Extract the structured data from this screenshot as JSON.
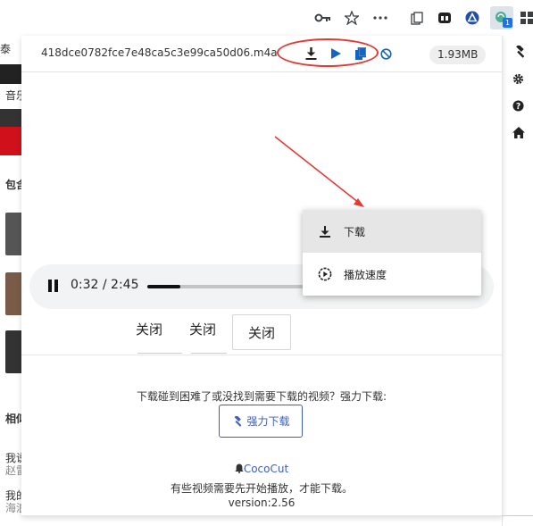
{
  "browser": {
    "toolbar_icons": [
      "key-icon",
      "star-icon",
      "more-icon",
      "collections-icon",
      "ext-dark-icon",
      "ext-delta-icon",
      "cococut-extension-icon",
      "extensions-grid-icon"
    ],
    "extension_badge": "1"
  },
  "background_page": {
    "texts": [
      "泰",
      "音乐",
      "包含",
      "相似",
      "我说",
      "赵雷",
      "我的",
      "海浪"
    ]
  },
  "sidebar": {
    "icons": [
      "hammer-icon",
      "gear-icon",
      "help-icon",
      "home-icon"
    ]
  },
  "popup": {
    "filename": "418dce0782fce7e48ca5c3e99ca50d06.m4a",
    "file_size": "1.93MB",
    "header_actions": [
      "download-icon",
      "play-icon",
      "copy-icon",
      "block-icon"
    ],
    "player": {
      "time": "0:32 / 2:45",
      "progress": 0.194
    },
    "context_menu": {
      "items": [
        {
          "label": "下载",
          "icon": "download-icon"
        },
        {
          "label": "播放速度",
          "icon": "playback-speed-icon"
        }
      ]
    },
    "close_buttons": [
      "关闭",
      "关闭",
      "关闭"
    ],
    "help_text": "下载碰到困难了或没找到需要下载的视频？强力下载:",
    "force_download_label": "强力下载",
    "brand_name": "CocoCut",
    "note_text": "有些视频需要先开始播放，才能下载。",
    "version": "version:2.56"
  },
  "colors": {
    "accent_blue": "#3f5fb5",
    "annotation_red": "#e53935"
  }
}
